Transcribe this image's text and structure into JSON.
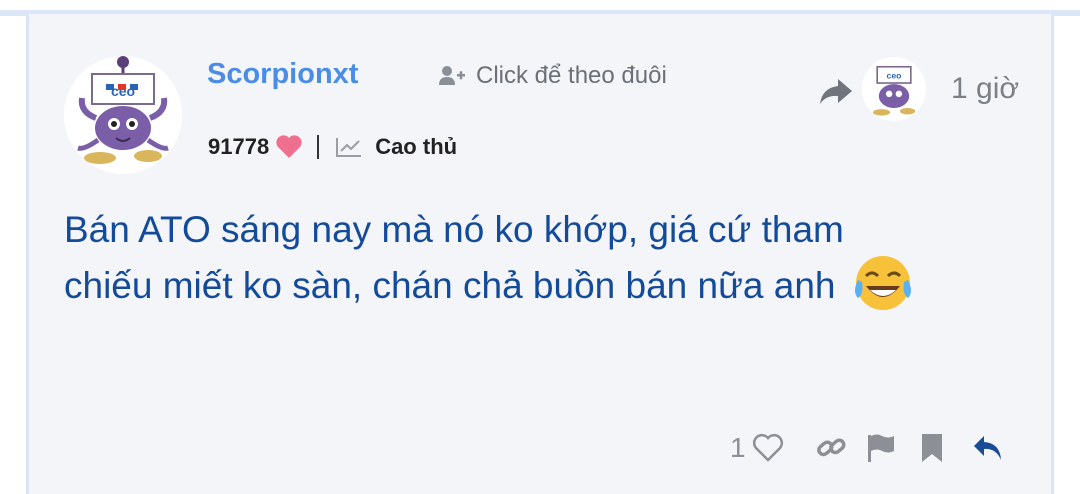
{
  "post": {
    "username": "Scorpionxt",
    "follow_label": "Click để theo đuôi",
    "points": "91778",
    "rank": "Cao thủ",
    "time": "1 giờ",
    "content_line1": "Bán ATO sáng nay mà nó ko khớp, giá cứ tham",
    "content_line2": "chiếu miết ko sàn, chán chả buồn bán nữa anh",
    "emoji": "face-with-tears-of-joy",
    "like_count": "1",
    "avatar_text": "ceo",
    "small_avatar_text": "ceo"
  },
  "colors": {
    "username": "#4a8de6",
    "content": "#134a9a",
    "heart": "#f06e8e",
    "reply": "#1a4c96",
    "card_bg": "#f4f5f9"
  },
  "icons": [
    "follow-user-icon",
    "heart-icon",
    "rank-chart-icon",
    "share-icon",
    "like-heart-icon",
    "link-icon",
    "flag-icon",
    "bookmark-icon",
    "reply-icon"
  ]
}
